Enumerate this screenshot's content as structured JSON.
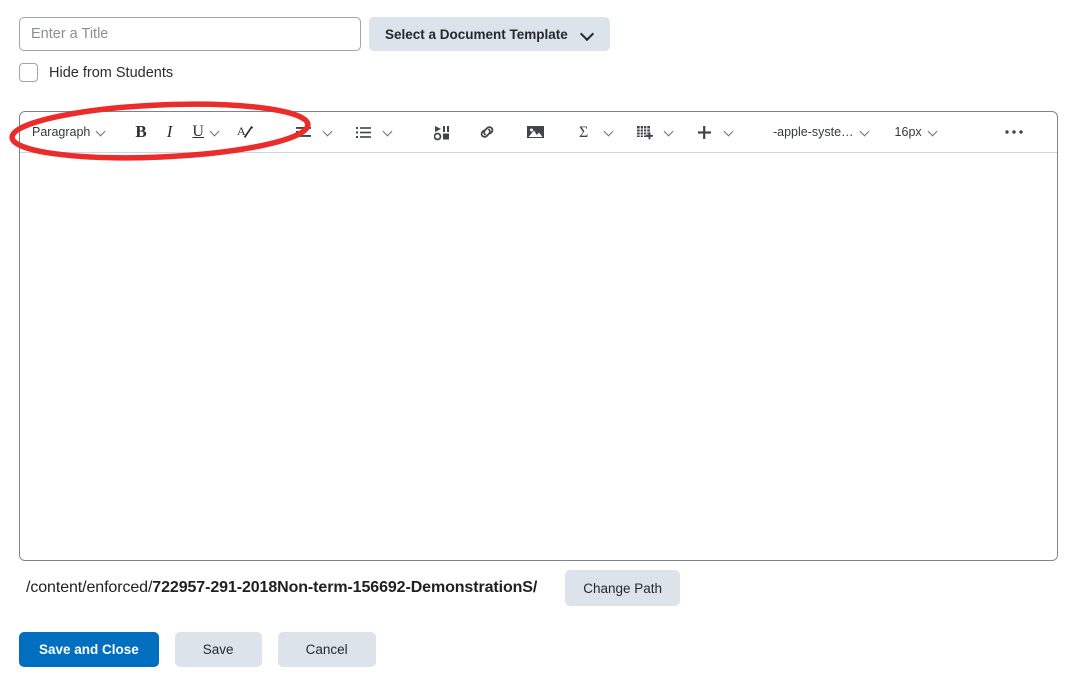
{
  "header": {
    "title_placeholder": "Enter a Title",
    "title_value": "",
    "template_button": "Select a Document Template",
    "template_chevron_icon": "chevron-down-icon",
    "hide_from_students_label": "Hide from Students",
    "hide_from_students_checked": false
  },
  "toolbar": {
    "paragraph_style": "Paragraph",
    "bold_label": "B",
    "italic_label": "I",
    "underline_label": "U",
    "format_clear_icon": "a-pencil-icon",
    "align_icon": "align-left-icon",
    "list_icon": "bulleted-list-icon",
    "media_icon": "insert-media-icon",
    "link_icon": "link-icon",
    "image_icon": "image-icon",
    "equation_icon": "sigma-equation-icon",
    "table_icon": "insert-table-icon",
    "plus_icon": "plus-insert-icon",
    "font_family": "-apple-syste…",
    "font_size": "16px",
    "more_icon": "ellipsis-icon",
    "fullscreen_icon": "expand-fullscreen-icon",
    "chevron_icon": "chevron-down-icon"
  },
  "editor": {
    "content": "",
    "resize_icon": "resize-grip-icon"
  },
  "path": {
    "prefix": "/content/enforced/",
    "folder": "722957-291-2018Non-term-156692-DemonstrationS/",
    "change_button": "Change Path"
  },
  "footer": {
    "save_and_close": "Save and Close",
    "save": "Save",
    "cancel": "Cancel"
  },
  "annotation": {
    "shape": "red-ellipse-highlight",
    "color": "#ec2b2b"
  },
  "colors": {
    "primary_button": "#006fbf",
    "secondary_button": "#dde3ea",
    "annotation_red": "#ec2b2b",
    "editor_border": "#7f8488"
  }
}
